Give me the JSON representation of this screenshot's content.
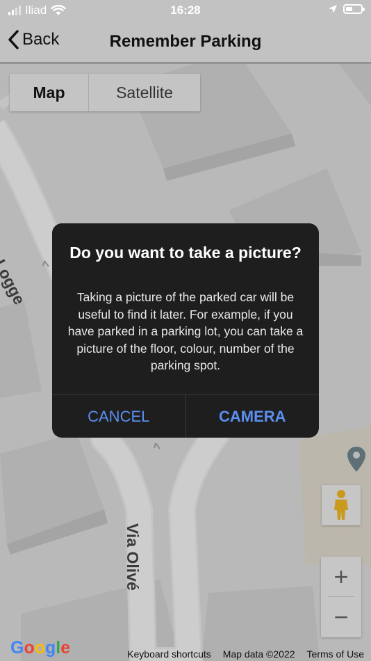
{
  "status_bar": {
    "carrier": "Iliad",
    "time": "16:28"
  },
  "nav": {
    "back_label": "Back",
    "title": "Remember Parking"
  },
  "map": {
    "type_options": [
      "Map",
      "Satellite"
    ],
    "selected_type": "Map",
    "road_labels": [
      "via delle Logge",
      "Via Olivé"
    ],
    "zoom_in": "+",
    "zoom_out": "−",
    "logo": [
      "G",
      "o",
      "o",
      "g",
      "l",
      "e"
    ],
    "footer": {
      "shortcuts": "Keyboard shortcuts",
      "map_data": "Map data ©2022",
      "terms": "Terms of Use"
    }
  },
  "dialog": {
    "title": "Do you want to take a picture?",
    "body": "Taking a picture of the parked car will be useful to find it later. For example, if you have parked in a parking lot, you can take a picture of the floor, colour, number of the parking spot.",
    "cancel_label": "CANCEL",
    "camera_label": "CAMERA"
  },
  "colors": {
    "dialog_bg": "#1e1e1e",
    "button_text": "#5b8ff0",
    "google_blue": "#4285f4",
    "google_red": "#ea4335",
    "google_yellow": "#fbbc05",
    "google_green": "#34a853"
  }
}
